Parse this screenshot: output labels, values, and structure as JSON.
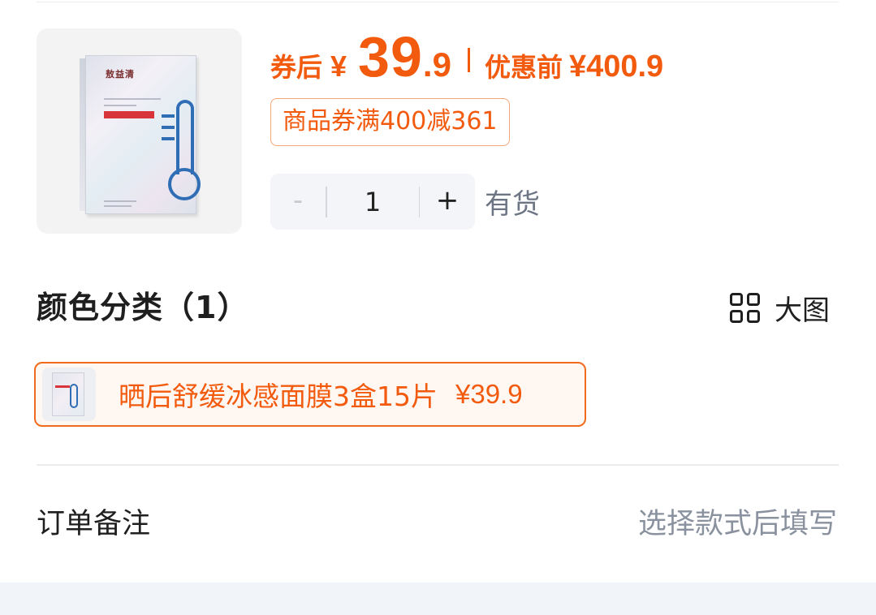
{
  "product": {
    "image_icon": "face-mask-box-image"
  },
  "price": {
    "after_coupon_label": "券后",
    "currency": "¥",
    "integer": "39",
    "decimal": ".9",
    "original_label": "优惠前",
    "original_value": "¥400.9",
    "accent_color": "#f25a0e"
  },
  "coupon": {
    "text": "商品券满400减361"
  },
  "quantity": {
    "minus": "-",
    "value": "1",
    "plus": "+",
    "stock_status": "有货"
  },
  "variants": {
    "title": "颜色分类（1）",
    "view_toggle_label": "大图",
    "view_toggle_icon": "grid-view-icon",
    "items": [
      {
        "name": "晒后舒缓冰感面膜3盒15片",
        "price": "¥39.9",
        "selected": true
      }
    ]
  },
  "remark": {
    "label": "订单备注",
    "hint": "选择款式后填写"
  }
}
